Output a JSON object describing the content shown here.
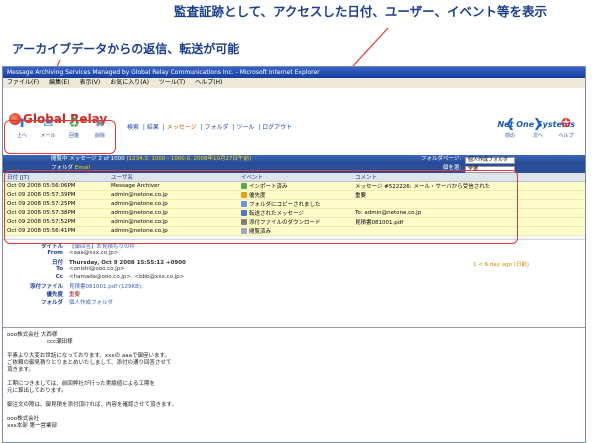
{
  "callouts": {
    "top": "監査証跡として、アクセスした日付、ユーザー、イベント等を表示",
    "left": "アーカイブデータからの返信、転送が可能"
  },
  "window": {
    "title": "Message Archiving Services Managed by Global Relay Communications Inc. - Microsoft Internet Explorer",
    "menu": [
      "ファイル(F)",
      "編集(E)",
      "表示(V)",
      "お気に入り(A)",
      "ツール(T)",
      "ヘルプ(H)"
    ]
  },
  "app": {
    "logo": "Global Relay",
    "partner": "Net One Systems",
    "nav": [
      "検索",
      "結果",
      "メッセージ",
      "フォルダ",
      "ツール",
      "ログアウト"
    ],
    "nav_active": "メッセージ",
    "tools_left": [
      {
        "label": "上へ",
        "icon": "up-arrow-icon",
        "glyph": "⬆"
      },
      {
        "label": "メール",
        "icon": "mail-icon",
        "glyph": "✉"
      },
      {
        "label": "回復",
        "icon": "recover-icon",
        "glyph": "♻"
      },
      {
        "label": "削除",
        "icon": "delete-icon",
        "glyph": "✖"
      }
    ],
    "tools_right": [
      {
        "label": "前の",
        "icon": "prev-icon",
        "glyph": "❮"
      },
      {
        "label": "次へ",
        "icon": "next-icon",
        "glyph": "❯"
      },
      {
        "label": "ヘルプ",
        "icon": "help-icon",
        "glyph": "✪"
      }
    ]
  },
  "status": {
    "viewing_prefix": "閲覧中 ",
    "viewing_count": "メッセージ 2 of 1000",
    "viewing_extra": "(1234.3, 1000 - 1000.0, 2008年10月27日午前)",
    "folder_label": "フォルダ",
    "folder_value": "Email",
    "folder_page_label": "フォルダページ:",
    "folder_page_value": "個人作成フォルダ",
    "select_label": "個を選:",
    "select_value": "全選"
  },
  "audit_table": {
    "headers": [
      "日付 [JT]",
      "ユーザ名",
      "イベント",
      "コメント"
    ],
    "rows": [
      [
        "Oct 09 2008 05:56:06PM",
        "Message Archiver",
        "インポート済み",
        "メッセージ #522226: メール・サーバから受信された"
      ],
      [
        "Oct 09 2008 05:57:39PM",
        "admin@netone.co.jp",
        "優先度",
        "重要"
      ],
      [
        "Oct 09 2008 05:57:25PM",
        "admin@netone.co.jp",
        "フォルダにコピーされました",
        ""
      ],
      [
        "Oct 09 2008 05:57:38PM",
        "admin@netone.co.jp",
        "転送されたメッセージ",
        "To: admin@netone.co.jp"
      ],
      [
        "Oct 09 2008 05:57:52PM",
        "admin@netone.co.jp",
        "添付ファイルのダウンロード",
        "見積書081001.pdf"
      ],
      [
        "Oct 09 2008 05:56:41PM",
        "admin@netone.co.jp",
        "閲覧済み",
        ""
      ]
    ]
  },
  "detail": {
    "subject_label": "タイトル",
    "subject": "【御回答】お見積もりの件",
    "from_label": "From",
    "from": "<aaa@xxx.co.jp>",
    "date_label": "日付",
    "date": "Thursday, Oct 9 2008 15:55:12 +0900",
    "age": "1 < 6 day ago (日前)",
    "to_label": "To",
    "to": "<onishi@ooo.co.jp>",
    "cc_label": "Cc",
    "cc": "<hamada@ooo.co.jp>, <bbb@xxx.co.jp>",
    "attach_label": "添付ファイル",
    "attach": "見積書081001.pdf (129KB);",
    "priority_label": "優先度",
    "priority": "重要",
    "folder_label": "フォルダ",
    "folder": "個人作成フォルダ"
  },
  "body_lines": [
    "ooo株式会社 大西様",
    "ccc瀬田様",
    "",
    "平素より大変お世話になっております。xxxの aaaで御座います。",
    "ご依頼の御見積りとりまとめいたしまして、添付の通り回答させて",
    "頂きます。",
    "",
    "工期につきましては、前回弊社が行った実績値による工期を",
    "元に算出しております。",
    "",
    "御注文の際は、御見積を添付頂ければ、内容を確認させて頂きます。",
    "",
    "ooo株式会社",
    "xxx本部 第一営業部"
  ]
}
